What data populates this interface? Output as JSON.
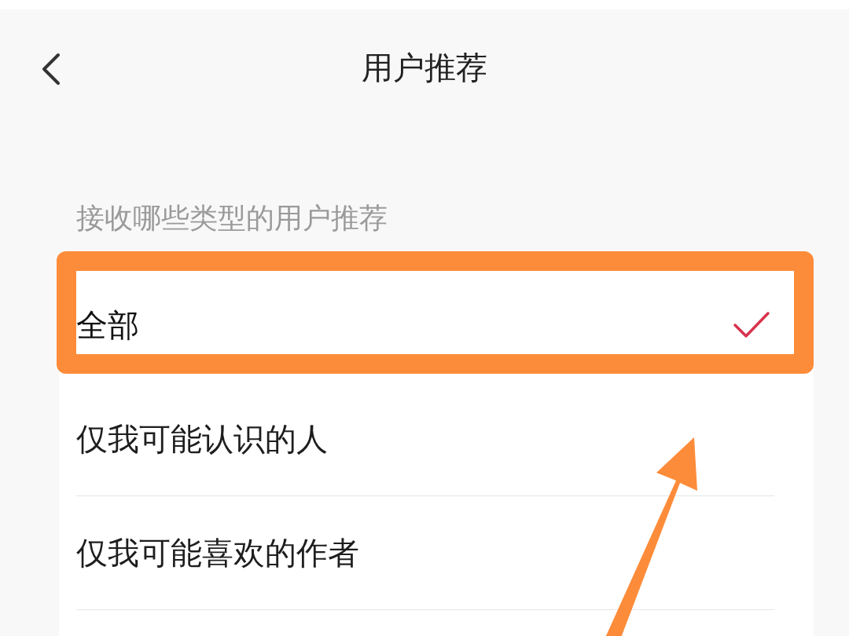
{
  "header": {
    "title": "用户推荐"
  },
  "section_label": "接收哪些类型的用户推荐",
  "options": [
    {
      "label": "全部",
      "selected": true
    },
    {
      "label": "仅我可能认识的人",
      "selected": false
    },
    {
      "label": "仅我可能喜欢的作者",
      "selected": false
    }
  ]
}
